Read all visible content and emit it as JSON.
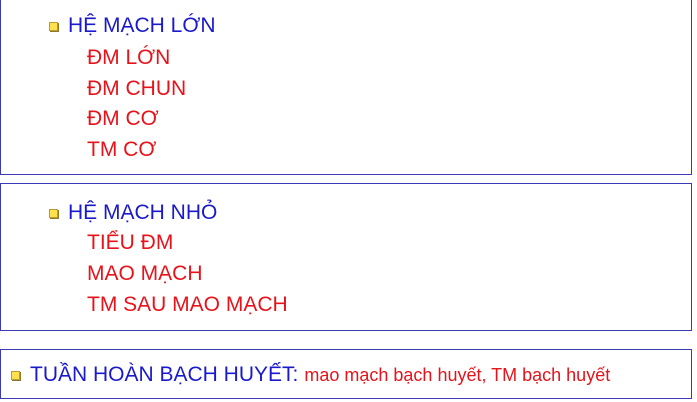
{
  "large_vessels": {
    "heading": "HỆ MẠCH LỚN",
    "items": [
      "ĐM LỚN",
      "ĐM CHUN",
      "ĐM CƠ",
      "TM CƠ"
    ]
  },
  "small_vessels": {
    "heading": "HỆ MẠCH NHỎ",
    "items": [
      "TIỂU ĐM",
      "MAO MẠCH",
      "TM SAU MAO MẠCH"
    ]
  },
  "lymph": {
    "heading": "TUẦN HOÀN BẠCH HUYẾT:",
    "detail": "mao mạch bạch huyết, TM bạch huyết"
  },
  "colors": {
    "heading": "#1a1acc",
    "item": "#e6131a",
    "border": "#3b3bb8",
    "bullet": "#ffe14d"
  },
  "icons": {
    "bullet": "yellow-square-bullet-icon"
  }
}
